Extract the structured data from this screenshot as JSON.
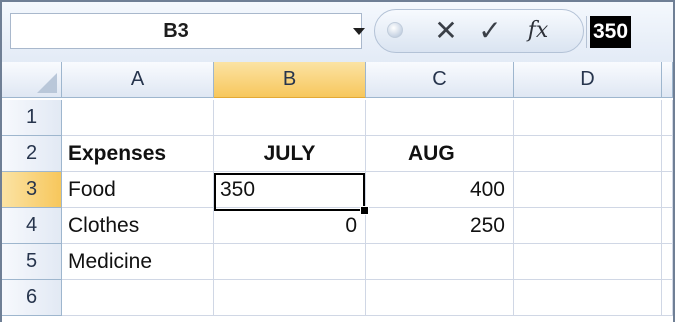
{
  "formula_bar": {
    "name_box": "B3",
    "cancel_glyph": "✕",
    "enter_glyph": "✓",
    "fx_label": "fx",
    "formula_value": "350"
  },
  "columns": [
    "A",
    "B",
    "C",
    "D"
  ],
  "rows": [
    {
      "number": "1",
      "a": "",
      "b": "",
      "c": "",
      "d": ""
    },
    {
      "number": "2",
      "a": "Expenses",
      "b": "JULY",
      "c": "AUG",
      "d": ""
    },
    {
      "number": "3",
      "a": "Food",
      "b": "350",
      "c": "400",
      "d": ""
    },
    {
      "number": "4",
      "a": "Clothes",
      "b": "0",
      "c": "250",
      "d": ""
    },
    {
      "number": "5",
      "a": "Medicine",
      "b": "",
      "c": "",
      "d": ""
    },
    {
      "number": "6",
      "a": "",
      "b": "",
      "c": "",
      "d": ""
    }
  ],
  "selected_cell": "B3",
  "icons": {
    "cancel": "close-icon",
    "enter": "checkmark-icon",
    "function": "fx-icon",
    "bubble": "bubble-icon",
    "dropdown": "chevron-down-icon"
  },
  "colors": {
    "active_header": "#f7c75c",
    "header_bg": "#dfe7f3",
    "gridline": "#d0d7e5",
    "formula_highlight": "#000000"
  }
}
